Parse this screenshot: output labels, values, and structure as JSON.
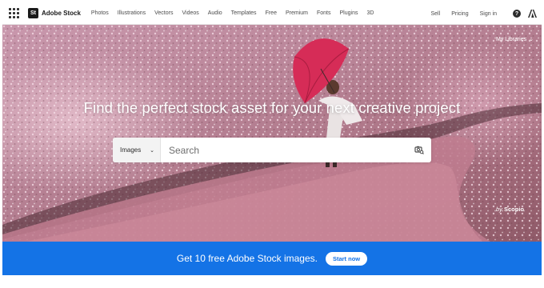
{
  "brand": {
    "badge": "St",
    "name": "Adobe Stock"
  },
  "nav": {
    "links": [
      "Photos",
      "Illustrations",
      "Vectors",
      "Videos",
      "Audio",
      "Templates",
      "Free",
      "Premium",
      "Fonts",
      "Plugins",
      "3D"
    ],
    "right_links": [
      "Sell",
      "Pricing",
      "Sign in"
    ],
    "help_glyph": "?"
  },
  "hero": {
    "headline": "Find the perfect stock asset for your next creative project",
    "my_libraries": "My Libraries",
    "credit_prefix": "by",
    "credit_name": "Scopio"
  },
  "search": {
    "type_selected": "Images",
    "placeholder": "Search",
    "value": ""
  },
  "promo": {
    "text": "Get 10 free Adobe Stock images.",
    "button_label": "Start now"
  },
  "colors": {
    "promo_blue": "#1473e6",
    "hero_base": "#b88396",
    "umbrella": "#d62c57"
  },
  "icons": [
    "apps-grid-icon",
    "help-icon",
    "adobe-logo-icon",
    "chevron-down-icon",
    "camera-search-icon"
  ]
}
